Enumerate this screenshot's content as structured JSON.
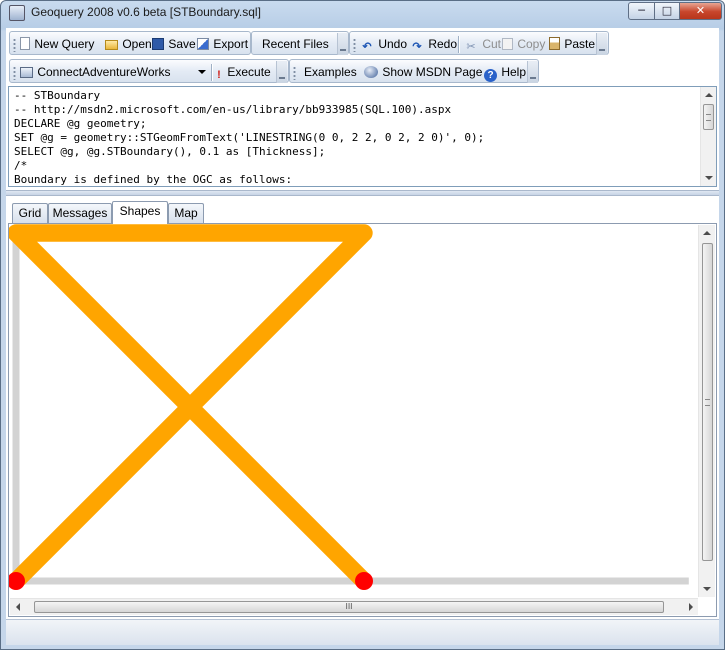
{
  "window": {
    "title": "Geoquery 2008 v0.6 beta [STBoundary.sql]",
    "min_glyph": "─",
    "max_glyph": "□",
    "close_glyph": "✕"
  },
  "toolbar1": {
    "new_query": "New Query",
    "open": "Open",
    "save": "Save",
    "export": "Export",
    "recent_files": "Recent Files",
    "undo": "Undo",
    "redo": "Redo",
    "cut": "Cut",
    "copy": "Copy",
    "paste": "Paste"
  },
  "toolbar2": {
    "connect": "Connect",
    "database": "AdventureWorks",
    "execute": "Execute",
    "examples": "Examples",
    "show_msdn": "Show MSDN Page",
    "help": "Help"
  },
  "editor": {
    "lines": [
      "-- STBoundary",
      "-- http://msdn2.microsoft.com/en-us/library/bb933985(SQL.100).aspx",
      "DECLARE @g geometry;",
      "SET @g = geometry::STGeomFromText('LINESTRING(0 0, 2 2, 0 2, 2 0)', 0);",
      "SELECT @g, @g.STBoundary(), 0.1 as [Thickness];",
      "/*",
      "Boundary is defined by the OGC as follows:"
    ]
  },
  "tabs": [
    {
      "label": "Grid",
      "active": false
    },
    {
      "label": "Messages",
      "active": false
    },
    {
      "label": "Shapes",
      "active": true
    },
    {
      "label": "Map",
      "active": false
    }
  ],
  "shapes": {
    "linestring": [
      [
        0,
        0
      ],
      [
        2,
        2
      ],
      [
        0,
        2
      ],
      [
        2,
        0
      ]
    ],
    "boundary_points": [
      [
        0,
        0
      ],
      [
        2,
        0
      ]
    ],
    "thickness": 0.1,
    "line_color": "#ffa500",
    "point_color": "#ff0000",
    "extent_line_color": "#d3d3d3"
  },
  "hscroll_glyph": "III",
  "colors": {
    "accent": "#ffa500",
    "boundary": "#ff0000"
  }
}
